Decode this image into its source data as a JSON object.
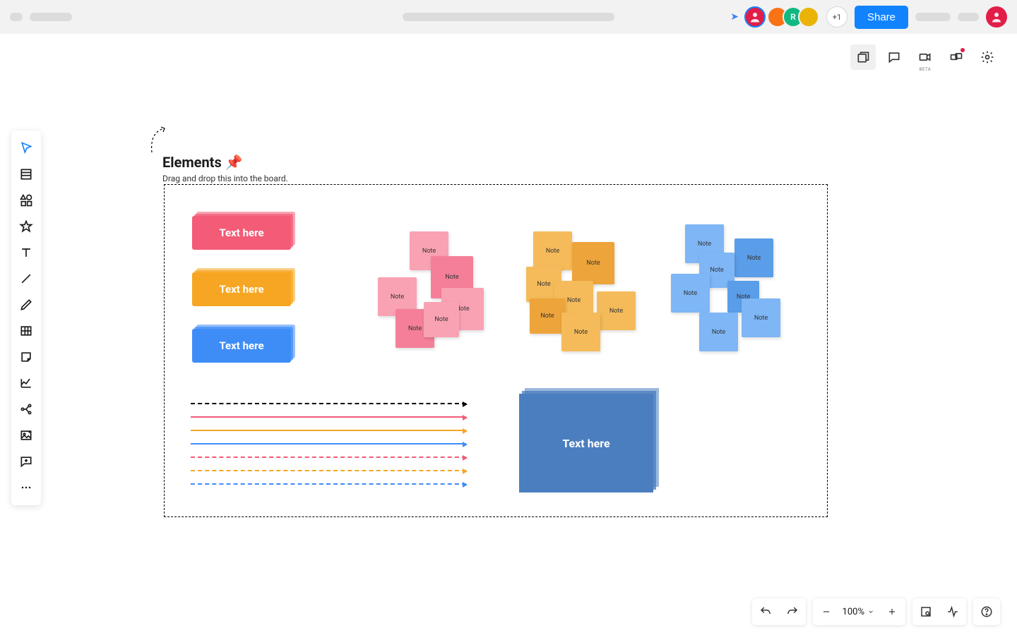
{
  "header": {
    "plus_count_label": "+1",
    "share_label": "Share",
    "collaborators": [
      {
        "color": "#e11d48",
        "initial": ""
      },
      {
        "color": "#f97316",
        "initial": ""
      },
      {
        "color": "#10b981",
        "initial": "R"
      },
      {
        "color": "#eab308",
        "initial": ""
      }
    ]
  },
  "right_tools": {
    "beta_label": "BETA"
  },
  "left_toolbar": {
    "items": [
      "cursor",
      "template",
      "shapes",
      "star",
      "text",
      "line",
      "pen",
      "table",
      "sticky",
      "chart",
      "mindmap",
      "image",
      "comment",
      "more"
    ]
  },
  "canvas": {
    "title": "Elements 📌",
    "subtitle": "Drag and drop this into the board.",
    "tags": [
      {
        "label": "Text here",
        "color": "#f35b77"
      },
      {
        "label": "Text here",
        "color": "#f5a623"
      },
      {
        "label": "Text here",
        "color": "#3f8df7"
      }
    ],
    "note_label": "Note",
    "cluster_colors": {
      "pink": {
        "light": "#f9a2b4",
        "dark": "#f57f99"
      },
      "orange": {
        "light": "#f5bb5a",
        "dark": "#eda43b"
      },
      "blue": {
        "light": "#7eb6f6",
        "dark": "#5a9de8"
      }
    },
    "arrows": [
      {
        "color": "#000000",
        "dashed": true
      },
      {
        "color": "#f35b77",
        "dashed": false
      },
      {
        "color": "#f5a623",
        "dashed": false
      },
      {
        "color": "#3f8df7",
        "dashed": false
      },
      {
        "color": "#f35b77",
        "dashed": true
      },
      {
        "color": "#f5a623",
        "dashed": true
      },
      {
        "color": "#3f8df7",
        "dashed": true
      }
    ],
    "big_label": "Text here"
  },
  "bottombar": {
    "zoom_label": "100%"
  }
}
